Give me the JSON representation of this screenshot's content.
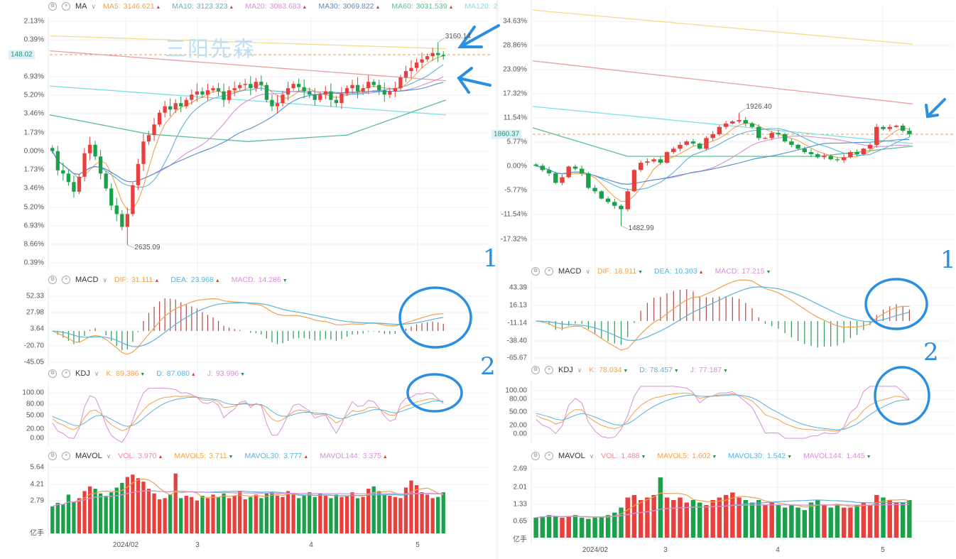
{
  "watermark": "三阳先森",
  "annotations": {
    "label_1": "1",
    "label_2": "2",
    "color": "#2a8fe0"
  },
  "colors": {
    "up": "#e8403d",
    "down": "#1aa14a",
    "MA5": "#f0a24e",
    "MA10": "#5ab4d8",
    "MA20": "#d890d8",
    "MA30": "#4f8fd0",
    "MA60": "#5fbf8f",
    "MA120": "#7fe0e8",
    "price_line": "#e0a050"
  },
  "left": {
    "ma_header": {
      "name": "MA",
      "items": [
        {
          "label": "MA5:",
          "value": "3146.621",
          "dir": "up",
          "color": "#f0a24e"
        },
        {
          "label": "MA10:",
          "value": "3123.323",
          "dir": "up",
          "color": "#5ab4d8"
        },
        {
          "label": "MA20:",
          "value": "3083.683",
          "dir": "up",
          "color": "#d890d8"
        },
        {
          "label": "MA30:",
          "value": "3069.822",
          "dir": "up",
          "color": "#4f8fd0"
        },
        {
          "label": "MA60:",
          "value": "3031.539",
          "dir": "up",
          "color": "#5fbf8f"
        },
        {
          "label": "MA120:",
          "value": "2",
          "dir": "",
          "color": "#7fe0e8"
        }
      ]
    },
    "macd_header": {
      "name": "MACD",
      "items": [
        {
          "label": "DIF:",
          "value": "31.111",
          "dir": "up",
          "color": "#f0a24e"
        },
        {
          "label": "DEA:",
          "value": "23.968",
          "dir": "up",
          "color": "#5ab4d8"
        },
        {
          "label": "MACD:",
          "value": "14.286",
          "dir": "dn",
          "color": "#d890d8"
        }
      ]
    },
    "kdj_header": {
      "name": "KDJ",
      "items": [
        {
          "label": "K:",
          "value": "89.386",
          "dir": "dn",
          "color": "#f0a24e"
        },
        {
          "label": "D:",
          "value": "87.080",
          "dir": "up",
          "color": "#5ab4d8"
        },
        {
          "label": "J:",
          "value": "93.996",
          "dir": "dn",
          "color": "#d890d8"
        }
      ]
    },
    "vol_header": {
      "name": "MAVOL",
      "items": [
        {
          "label": "VOL:",
          "value": "3.970",
          "dir": "up",
          "color": "#e88a9a"
        },
        {
          "label": "MAVOL5:",
          "value": "3.711",
          "dir": "dn",
          "color": "#f0a24e"
        },
        {
          "label": "MAVOL30:",
          "value": "3.777",
          "dir": "up",
          "color": "#5ab4d8"
        },
        {
          "label": "MAVOL144:",
          "value": "3.375",
          "dir": "up",
          "color": "#d890d8"
        }
      ]
    },
    "price_tag": "148.02",
    "main_ticks": [
      "2.13%",
      "0.39%",
      "6.93%",
      "5.20%",
      "3.46%",
      "1.73%",
      "0.00%",
      "1.73%",
      "3.46%",
      "5.20%",
      "6.93%",
      "8.66%",
      "0.39%"
    ],
    "macd_ticks": [
      "52.33",
      "27.98",
      "3.64",
      "-20.70",
      "-45.05"
    ],
    "kdj_ticks": [
      "100.00",
      "80.00",
      "50.00",
      "20.00",
      "0.00"
    ],
    "vol_ticks": [
      "5.64",
      "4.21",
      "2.79"
    ],
    "vol_unit": "亿手",
    "x_ticks": [
      "2024/02",
      "3",
      "4",
      "5"
    ],
    "extremes": [
      {
        "label": "2635.09",
        "index": 14,
        "value": -8.8,
        "kind": "low"
      },
      {
        "label": "3160.14",
        "index": 72,
        "value": 10.2,
        "kind": "high"
      }
    ]
  },
  "right": {
    "macd_header": {
      "name": "MACD",
      "items": [
        {
          "label": "DIF:",
          "value": "18.911",
          "dir": "dn",
          "color": "#f0a24e"
        },
        {
          "label": "DEA:",
          "value": "10.303",
          "dir": "up",
          "color": "#5ab4d8"
        },
        {
          "label": "MACD:",
          "value": "17.215",
          "dir": "dn",
          "color": "#d890d8"
        }
      ]
    },
    "kdj_header": {
      "name": "KDJ",
      "items": [
        {
          "label": "K:",
          "value": "78.034",
          "dir": "dn",
          "color": "#f0a24e"
        },
        {
          "label": "D:",
          "value": "78.457",
          "dir": "dn",
          "color": "#5ab4d8"
        },
        {
          "label": "J:",
          "value": "77.187",
          "dir": "dn",
          "color": "#d890d8"
        }
      ]
    },
    "vol_header": {
      "name": "MAVOL",
      "items": [
        {
          "label": "VOL:",
          "value": "1.488",
          "dir": "dn",
          "color": "#e88a9a"
        },
        {
          "label": "MAVOL5:",
          "value": "1.602",
          "dir": "dn",
          "color": "#f0a24e"
        },
        {
          "label": "MAVOL30:",
          "value": "1.542",
          "dir": "dn",
          "color": "#5ab4d8"
        },
        {
          "label": "MAVOL144:",
          "value": "1.445",
          "dir": "dn",
          "color": "#d890d8"
        }
      ]
    },
    "price_tag": "1860.37",
    "main_ticks": [
      "34.63%",
      "28.86%",
      "23.09%",
      "17.32%",
      "11.54%",
      "5.77%",
      "0.00%",
      "-5.77%",
      "-11.54%",
      "-17.32%"
    ],
    "macd_ticks": [
      "43.39",
      "16.13",
      "-11.14",
      "-38.40",
      "-65.67"
    ],
    "kdj_ticks": [
      "100.00",
      "80.00",
      "50.00",
      "20.00",
      "0.00"
    ],
    "vol_ticks": [
      "2.69",
      "2.01",
      "1.33",
      "0.65"
    ],
    "vol_unit": "亿手",
    "x_ticks": [
      "2024/02",
      "3",
      "4",
      "5"
    ],
    "extremes": [
      {
        "label": "1926.40",
        "index": 31,
        "value": 12.4,
        "kind": "high"
      },
      {
        "label": "1482.99",
        "index": 13,
        "value": -14.1,
        "kind": "low"
      }
    ]
  },
  "chart_data": [
    {
      "type": "candlestick",
      "panel": "left",
      "ylabel": "",
      "ylim": [
        -10.6,
        12.5
      ],
      "closes_pct": [
        0,
        -1.8,
        -2.1,
        -2.9,
        -3.8,
        -2.4,
        -0.2,
        0.6,
        -0.5,
        -2.1,
        -3.5,
        -5.1,
        -5.9,
        -7.1,
        -5.9,
        -3.2,
        -1.2,
        0.9,
        1.5,
        2.5,
        3.6,
        4.2,
        3.9,
        4.5,
        4.2,
        4.8,
        5.3,
        5.6,
        5.3,
        5.7,
        5.9,
        5.6,
        4.8,
        5.7,
        5.9,
        6.2,
        6.3,
        5.9,
        6.5,
        6.2,
        4.8,
        4.2,
        4.5,
        5.3,
        5.9,
        6.3,
        6.0,
        5.6,
        5.3,
        4.8,
        5.3,
        5.6,
        4.8,
        4.5,
        5.4,
        5.9,
        6.2,
        5.6,
        5.9,
        6.5,
        6.2,
        5.7,
        5.3,
        5.6,
        5.9,
        6.9,
        7.5,
        7.8,
        8.3,
        8.6,
        8.9,
        9.2,
        9.0,
        8.9
      ],
      "long_ma": [
        {
          "name": "MA120",
          "color": "#f3dc8c",
          "values": [
            10.8,
            9.6
          ]
        },
        {
          "name": "MA250",
          "color": "#e8a0a0",
          "values": [
            9.4,
            6.6
          ]
        },
        {
          "name": "MA60",
          "color": "#7fe0e8",
          "values": [
            6.1,
            3.4
          ]
        },
        {
          "name": "MA30",
          "color": "#5fbf8f",
          "values": [
            3.4,
            1.6,
            0.9,
            1.5,
            4.8
          ]
        }
      ],
      "volume": [
        2.3,
        2.6,
        2.5,
        3.3,
        2.7,
        3.0,
        3.6,
        4.0,
        3.8,
        3.4,
        3.2,
        3.5,
        3.9,
        4.3,
        4.8,
        5.0,
        4.7,
        4.4,
        3.8,
        3.4,
        2.9,
        3.0,
        3.3,
        5.1,
        3.0,
        3.2,
        3.1,
        2.8,
        3.2,
        3.0,
        3.3,
        3.1,
        3.4,
        3.0,
        3.2,
        3.6,
        2.9,
        3.1,
        3.3,
        3.0,
        3.4,
        3.5,
        3.2,
        3.1,
        3.6,
        3.3,
        3.0,
        3.2,
        3.5,
        3.1,
        3.4,
        3.2,
        3.0,
        3.3,
        3.1,
        3.2,
        3.5,
        3.0,
        3.1,
        3.8,
        4.0,
        3.6,
        3.3,
        3.2,
        3.1,
        3.0,
        3.9,
        4.5,
        4.1,
        3.5,
        3.3,
        3.0,
        3.1,
        3.5
      ],
      "vol_ylim": [
        0,
        6.1
      ]
    },
    {
      "type": "candlestick",
      "panel": "right",
      "ylabel": "",
      "ylim": [
        -21.1,
        37.2
      ],
      "closes_pct": [
        0,
        -1.0,
        -1.8,
        -4.0,
        -2.7,
        -0.2,
        -0.7,
        -1.8,
        -5.2,
        -6.0,
        -7.7,
        -8.5,
        -9.4,
        -10.2,
        -6.0,
        -1.0,
        0.7,
        1.0,
        1.5,
        0.7,
        3.2,
        4.0,
        4.9,
        5.7,
        5.2,
        4.0,
        6.5,
        7.4,
        9.1,
        9.9,
        10.4,
        10.7,
        9.9,
        9.1,
        6.5,
        6.5,
        7.7,
        7.4,
        5.7,
        4.9,
        4.0,
        3.2,
        2.7,
        2.0,
        2.3,
        1.5,
        1.3,
        2.0,
        3.2,
        2.7,
        4.0,
        4.9,
        9.1,
        8.6,
        9.1,
        9.4,
        8.2,
        7.4
      ],
      "long_ma": [
        {
          "name": "MA250",
          "color": "#f3dc8c",
          "values": [
            36.5,
            28.5
          ]
        },
        {
          "name": "MA120",
          "color": "#e8a0a0",
          "values": [
            24.6,
            14.5
          ]
        },
        {
          "name": "MA60",
          "color": "#7fe0e8",
          "values": [
            13.9,
            5.2
          ]
        },
        {
          "name": "MA30",
          "color": "#5fbf8f",
          "values": [
            8.9,
            2.2,
            2.2,
            2.2,
            4.6
          ]
        }
      ],
      "volume": [
        0.8,
        0.85,
        0.9,
        0.85,
        0.8,
        0.85,
        0.9,
        0.8,
        0.75,
        0.8,
        0.85,
        0.9,
        1.0,
        1.2,
        1.6,
        1.7,
        1.5,
        1.6,
        1.7,
        2.4,
        1.6,
        1.5,
        1.6,
        1.4,
        1.5,
        1.4,
        1.3,
        1.5,
        1.6,
        1.7,
        1.8,
        1.6,
        1.5,
        1.4,
        1.5,
        1.3,
        1.4,
        1.3,
        1.2,
        1.3,
        1.2,
        1.1,
        1.4,
        1.5,
        1.3,
        1.2,
        1.3,
        1.2,
        1.2,
        1.3,
        1.4,
        1.3,
        1.7,
        1.6,
        1.5,
        1.4,
        1.4,
        1.5
      ],
      "vol_ylim": [
        0,
        2.97
      ]
    }
  ]
}
